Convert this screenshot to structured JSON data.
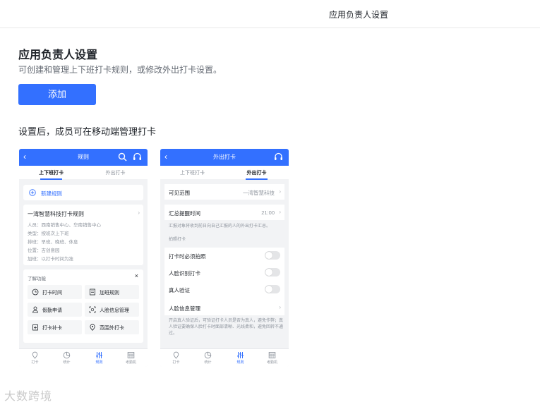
{
  "topbar": {
    "title": "应用负责人设置"
  },
  "page": {
    "title": "应用负责人设置",
    "description": "可创建和管理上下班打卡规则，或修改外出打卡设置。",
    "add_button": "添加",
    "section_title": "设置后，成员可在移动端管理打卡"
  },
  "phone1": {
    "header_title": "规则",
    "tabs": [
      "上下班打卡",
      "外出打卡"
    ],
    "new_rule": "新建规则",
    "rule_card": {
      "title": "一湾智慧科技打卡规则",
      "lines": [
        "人员：西南销售中心、华南销售中心",
        "类型：按班次上下班",
        "排班：早班、晚班、休息",
        "位置：吉创意园",
        "加班：以打卡时间为准"
      ]
    },
    "feature_panel": {
      "title": "了解功能",
      "close": "×",
      "items": [
        "打卡时间",
        "加班规则",
        "假勤申请",
        "人脸信息管理",
        "打卡补卡",
        "范围外打卡"
      ]
    },
    "nav": [
      "打卡",
      "统计",
      "规则",
      "考勤机"
    ]
  },
  "phone2": {
    "header_title": "外出打卡",
    "tabs": [
      "上下班打卡",
      "外出打卡"
    ],
    "visible_range": {
      "label": "可见范围",
      "value": "一湾智慧科技"
    },
    "summary_time": {
      "label": "汇总提醒时间",
      "value": "21:00"
    },
    "summary_note": "汇报对象将收到前日向自己汇报的人的外出打卡汇总。",
    "section_label": "拍照打卡",
    "toggles": [
      "打卡时必须拍照",
      "人脸识别打卡",
      "真人验证"
    ],
    "face_manage": "人脸信息管理",
    "bottom_note": "开启真人验证后，可验证打卡人员是否为真人，避免作弊；真人验证要确保人脸打卡时面部清晰、光线柔和，避免回转不通过。",
    "nav": [
      "打卡",
      "统计",
      "规则",
      "考勤机"
    ]
  },
  "watermark": "大数跨境",
  "colors": {
    "accent": "#3370ff",
    "background": "#f2f3f5"
  }
}
